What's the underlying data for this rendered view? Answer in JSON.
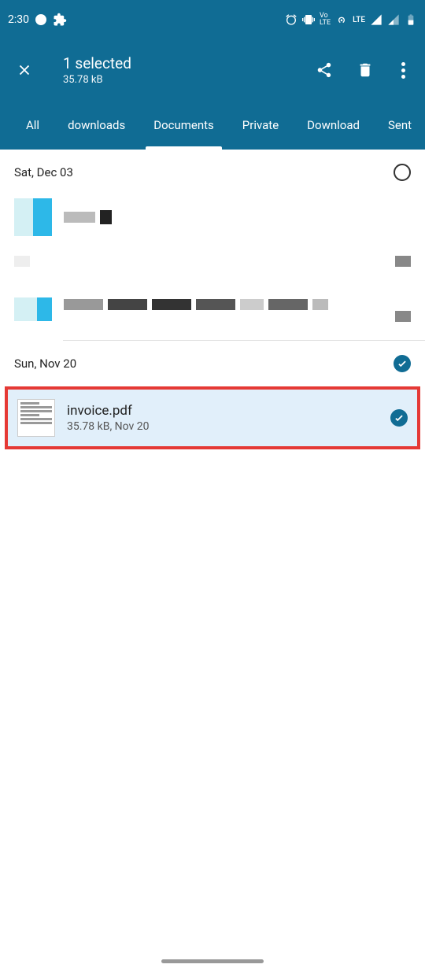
{
  "status": {
    "time": "2:30",
    "lte": "LTE"
  },
  "header": {
    "title": "1 selected",
    "subtitle": "35.78 kB"
  },
  "tabs": [
    {
      "label": "All",
      "active": false
    },
    {
      "label": "downloads",
      "active": false
    },
    {
      "label": "Documents",
      "active": true
    },
    {
      "label": "Private",
      "active": false
    },
    {
      "label": "Download",
      "active": false
    },
    {
      "label": "Sent",
      "active": false
    }
  ],
  "sections": [
    {
      "date": "Sat, Dec 03",
      "selected": false
    },
    {
      "date": "Sun, Nov 20",
      "selected": true
    }
  ],
  "selected_file": {
    "name": "invoice.pdf",
    "meta": "35.78 kB, Nov 20"
  }
}
